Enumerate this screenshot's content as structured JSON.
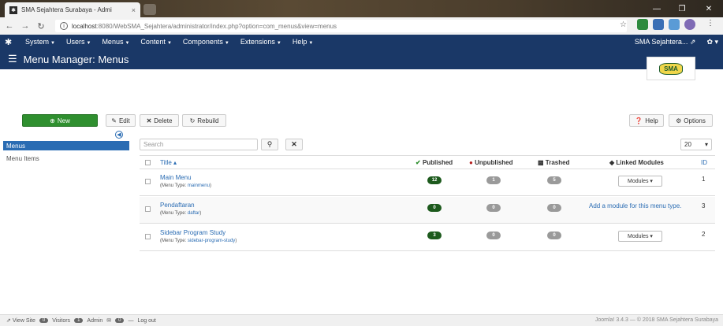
{
  "browser": {
    "tab_title": "SMA Sejahtera Surabaya - Admi",
    "tab_close": "×",
    "url_host": "localhost",
    "url_rest": ":8080/WebSMA_Sejahtera/administrator/index.php?option=com_menus&view=menus",
    "win_min": "—",
    "win_max": "❐",
    "win_close": "✕"
  },
  "adminnav": {
    "items": [
      {
        "label": "System"
      },
      {
        "label": "Users"
      },
      {
        "label": "Menus"
      },
      {
        "label": "Content"
      },
      {
        "label": "Components"
      },
      {
        "label": "Extensions"
      },
      {
        "label": "Help"
      }
    ],
    "site_label": "SMA Sejahtera..."
  },
  "header": {
    "title": "Menu Manager: Menus",
    "logo_text": "SMA"
  },
  "toolbar": {
    "new_label": "New",
    "edit_label": "Edit",
    "delete_label": "Delete",
    "rebuild_label": "Rebuild",
    "help_label": "Help",
    "options_label": "Options"
  },
  "sidebar": {
    "items": [
      {
        "label": "Menus",
        "active": true
      },
      {
        "label": "Menu Items",
        "active": false
      }
    ]
  },
  "filters": {
    "search_placeholder": "Search",
    "limit_value": "20"
  },
  "table": {
    "columns": {
      "title": "Title ▴",
      "published": "Published",
      "unpublished": "Unpublished",
      "trashed": "Trashed",
      "linked_modules": "Linked Modules",
      "id": "ID"
    },
    "menu_type_prefix": "(Menu Type: ",
    "menu_type_suffix": ")",
    "rows": [
      {
        "title": "Main Menu",
        "menu_type": "mainmenu",
        "published": "12",
        "unpublished": "1",
        "trashed": "5",
        "modules": "Modules ▾",
        "id": "1"
      },
      {
        "title": "Pendaftaran",
        "menu_type": "daftar",
        "published": "0",
        "unpublished": "0",
        "trashed": "0",
        "modules": "Add a module for this menu type.",
        "id": "3"
      },
      {
        "title": "Sidebar Program Study",
        "menu_type": "sidebar-program-study",
        "published": "3",
        "unpublished": "0",
        "trashed": "0",
        "modules": "Modules ▾",
        "id": "2"
      }
    ]
  },
  "statusbar": {
    "view_site": "View Site",
    "visitors_count": "0",
    "visitors_label": "Visitors",
    "admin_count": "1",
    "admin_label": "Admin",
    "messages_count": "0",
    "logout_label": "Log out",
    "version_text": "Joomla! 3.4.3 — © 2018 SMA Sejahtera Surabaya"
  }
}
